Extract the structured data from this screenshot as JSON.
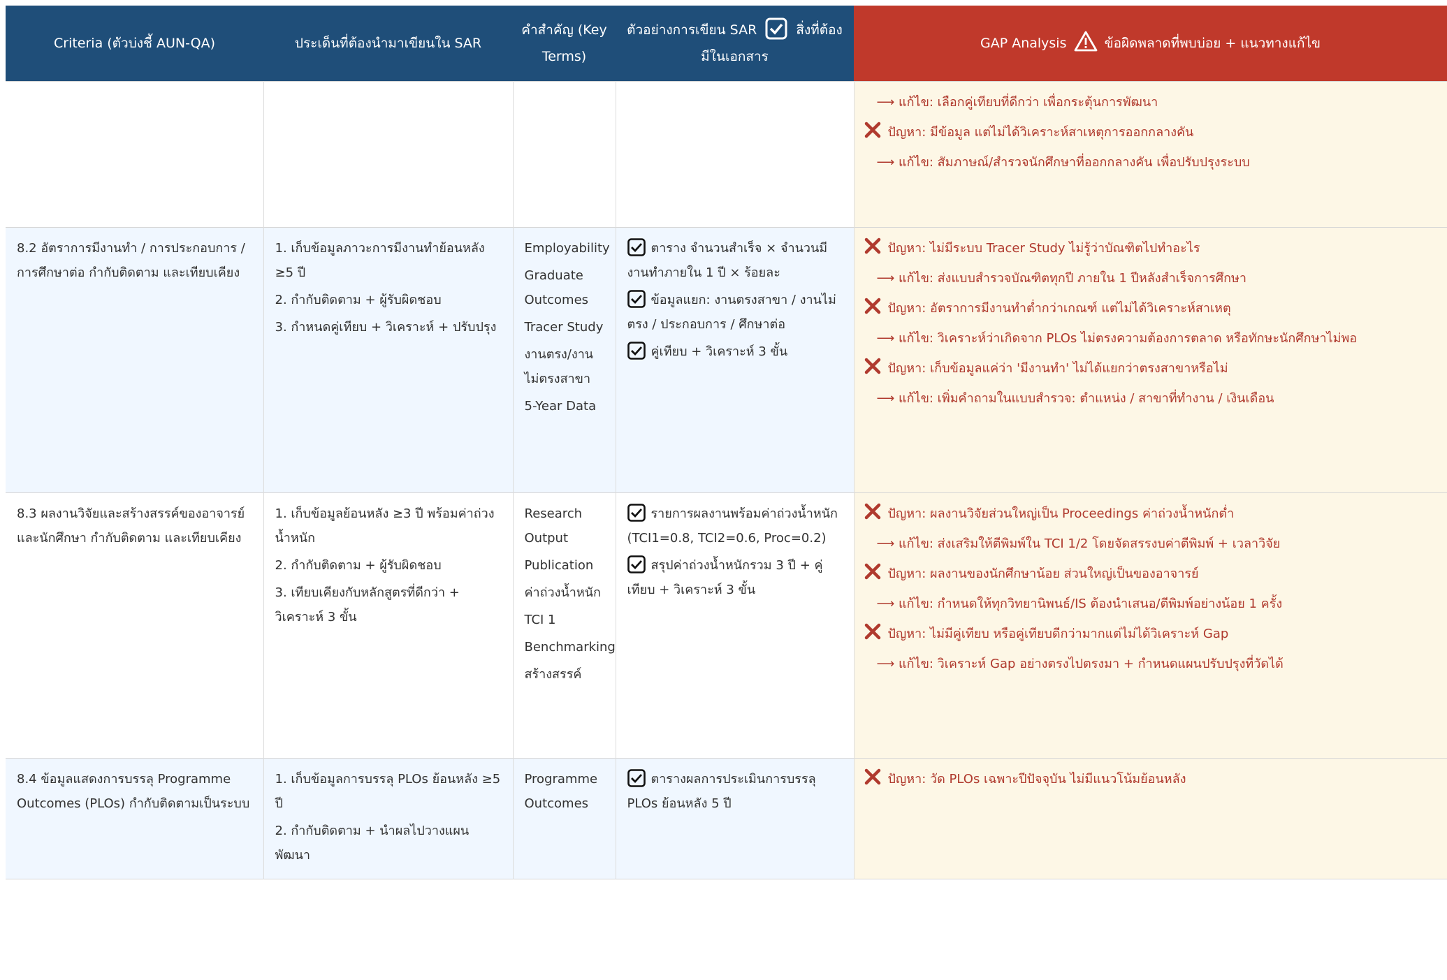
{
  "header": {
    "criteria": "Criteria (ตัวบ่งชี้ AUN-QA)",
    "issues": "ประเด็นที่ต้องนำมาเขียนใน SAR",
    "key_terms": "คำสำคัญ (Key Terms)",
    "example_a": "ตัวอย่างการเขียน SAR",
    "example_b": "สิ่งที่ต้องมีในเอกสาร",
    "gap_a": "GAP Analysis",
    "gap_b": "ข้อผิดพลาดที่พบบ่อย + แนวทางแก้ไข"
  },
  "rows": [
    {
      "criteria": "",
      "issues": [],
      "terms": [],
      "checks": [],
      "gap": [
        {
          "type": "fix",
          "text": "⟶ แก้ไข: เลือกคู่เทียบที่ดีกว่า เพื่อกระตุ้นการพัฒนา"
        },
        {
          "type": "problem",
          "text": "ปัญหา: มีข้อมูล แต่ไม่ได้วิเคราะห์สาเหตุการออกกลางคัน"
        },
        {
          "type": "fix",
          "text": "⟶ แก้ไข: สัมภาษณ์/สำรวจนักศึกษาที่ออกกลางคัน เพื่อปรับปรุงระบบ"
        }
      ]
    },
    {
      "criteria": "8.2 อัตราการมีงานทำ / การประกอบการ / การศึกษาต่อ กำกับติดตาม และเทียบเคียง",
      "issues": [
        "1. เก็บข้อมูลภาวะการมีงานทำย้อนหลัง ≥5 ปี",
        "2. กำกับติดตาม + ผู้รับผิดชอบ",
        "3. กำหนดคู่เทียบ + วิเคราะห์ + ปรับปรุง"
      ],
      "terms": [
        "Employability",
        "Graduate Outcomes",
        "Tracer Study",
        "งานตรง/งานไม่ตรงสาขา",
        "5-Year Data"
      ],
      "checks": [
        "ตาราง จำนวนสำเร็จ × จำนวนมีงานทำภายใน 1 ปี × ร้อยละ",
        "ข้อมูลแยก: งานตรงสาขา / งานไม่ตรง / ประกอบการ / ศึกษาต่อ",
        "คู่เทียบ + วิเคราะห์ 3 ขั้น"
      ],
      "gap": [
        {
          "type": "problem",
          "text": "ปัญหา: ไม่มีระบบ Tracer Study ไม่รู้ว่าบัณฑิตไปทำอะไร"
        },
        {
          "type": "fix",
          "text": "⟶ แก้ไข: ส่งแบบสำรวจบัณฑิตทุกปี ภายใน 1 ปีหลังสำเร็จการศึกษา"
        },
        {
          "type": "problem",
          "text": "ปัญหา: อัตราการมีงานทำต่ำกว่าเกณฑ์ แต่ไม่ได้วิเคราะห์สาเหตุ"
        },
        {
          "type": "fix",
          "text": "⟶ แก้ไข: วิเคราะห์ว่าเกิดจาก PLOs ไม่ตรงความต้องการตลาด หรือทักษะนักศึกษาไม่พอ"
        },
        {
          "type": "problem",
          "text": "ปัญหา: เก็บข้อมูลแค่ว่า 'มีงานทำ' ไม่ได้แยกว่าตรงสาขาหรือไม่"
        },
        {
          "type": "fix",
          "text": "⟶ แก้ไข: เพิ่มคำถามในแบบสำรวจ: ตำแหน่ง / สาขาที่ทำงาน / เงินเดือน"
        }
      ]
    },
    {
      "criteria": "8.3 ผลงานวิจัยและสร้างสรรค์ของอาจารย์และนักศึกษา กำกับติดตาม และเทียบเคียง",
      "issues": [
        "1. เก็บข้อมูลย้อนหลัง ≥3 ปี พร้อมค่าถ่วงน้ำหนัก",
        "2. กำกับติดตาม + ผู้รับผิดชอบ",
        "3. เทียบเคียงกับหลักสูตรที่ดีกว่า + วิเคราะห์ 3 ขั้น"
      ],
      "terms": [
        "Research Output",
        "Publication",
        "ค่าถ่วงน้ำหนัก",
        "TCI 1",
        "Benchmarking",
        "สร้างสรรค์"
      ],
      "checks": [
        "รายการผลงานพร้อมค่าถ่วงน้ำหนัก (TCI1=0.8, TCI2=0.6, Proc=0.2)",
        "สรุปค่าถ่วงน้ำหนักรวม 3 ปี + คู่เทียบ + วิเคราะห์ 3 ขั้น"
      ],
      "gap": [
        {
          "type": "problem",
          "text": "ปัญหา: ผลงานวิจัยส่วนใหญ่เป็น Proceedings ค่าถ่วงน้ำหนักต่ำ"
        },
        {
          "type": "fix",
          "text": "⟶ แก้ไข: ส่งเสริมให้ตีพิมพ์ใน TCI 1/2 โดยจัดสรรงบค่าตีพิมพ์ + เวลาวิจัย"
        },
        {
          "type": "problem",
          "text": "ปัญหา: ผลงานของนักศึกษาน้อย ส่วนใหญ่เป็นของอาจารย์"
        },
        {
          "type": "fix",
          "text": "⟶ แก้ไข: กำหนดให้ทุกวิทยานิพนธ์/IS ต้องนำเสนอ/ตีพิมพ์อย่างน้อย 1 ครั้ง"
        },
        {
          "type": "problem",
          "text": "ปัญหา: ไม่มีคู่เทียบ หรือคู่เทียบดีกว่ามากแต่ไม่ได้วิเคราะห์ Gap"
        },
        {
          "type": "fix",
          "text": "⟶ แก้ไข: วิเคราะห์ Gap อย่างตรงไปตรงมา + กำหนดแผนปรับปรุงที่วัดได้"
        }
      ]
    },
    {
      "criteria": "8.4 ข้อมูลแสดงการบรรลุ Programme Outcomes (PLOs) กำกับติดตามเป็นระบบ",
      "issues": [
        "1. เก็บข้อมูลการบรรลุ PLOs ย้อนหลัง ≥5 ปี",
        "2. กำกับติดตาม + นำผลไปวางแผนพัฒนา"
      ],
      "terms": [
        "Programme Outcomes"
      ],
      "checks": [
        "ตารางผลการประเมินการบรรลุ PLOs ย้อนหลัง 5 ปี"
      ],
      "gap": [
        {
          "type": "problem",
          "text": "ปัญหา: วัด PLOs เฉพาะปีปัจจุบัน ไม่มีแนวโน้มย้อนหลัง"
        }
      ]
    }
  ]
}
